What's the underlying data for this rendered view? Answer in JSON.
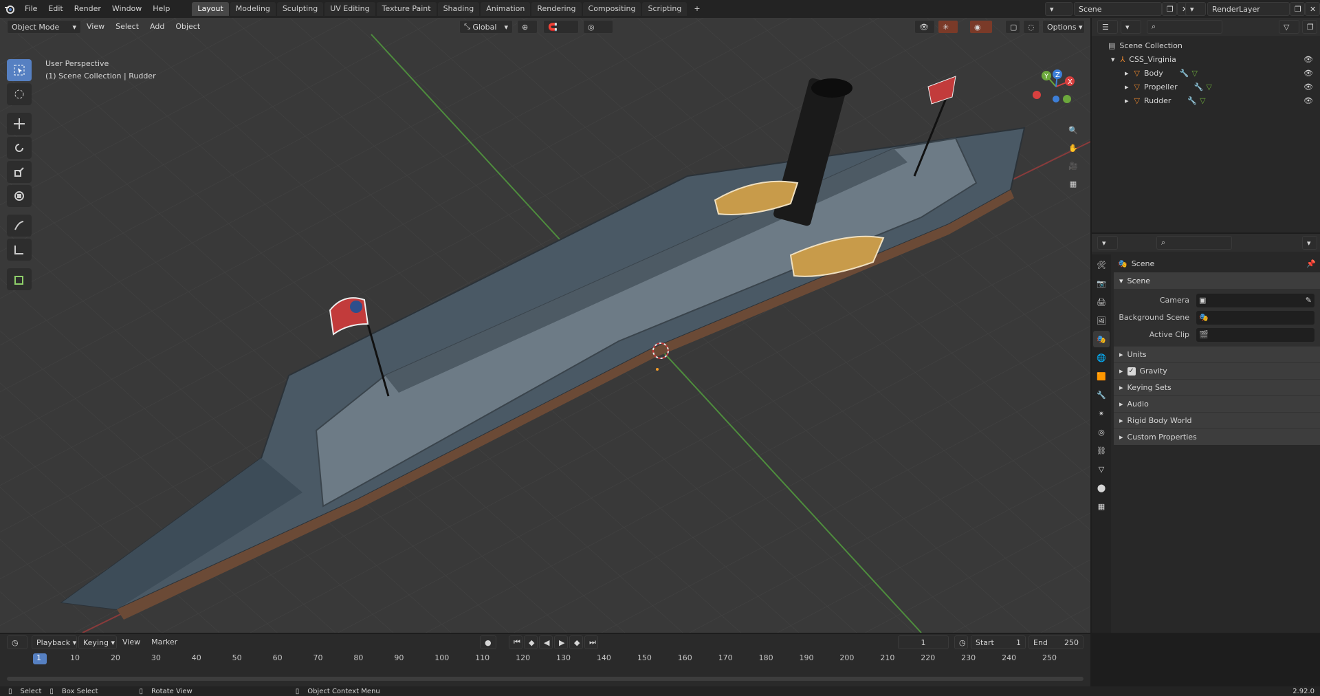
{
  "menu": {
    "items": [
      "File",
      "Edit",
      "Render",
      "Window",
      "Help"
    ]
  },
  "workspaces": [
    "Layout",
    "Modeling",
    "Sculpting",
    "UV Editing",
    "Texture Paint",
    "Shading",
    "Animation",
    "Rendering",
    "Compositing",
    "Scripting"
  ],
  "active_workspace": "Layout",
  "top_right": {
    "scene": "Scene",
    "view_layer": "RenderLayer"
  },
  "viewport": {
    "mode": "Object Mode",
    "menus": [
      "View",
      "Select",
      "Add",
      "Object"
    ],
    "transform_orientation": "Global",
    "options_label": "Options",
    "overlay_title": "User Perspective",
    "overlay_sub": "(1) Scene Collection | Rudder",
    "gizmo": {
      "x": "X",
      "y": "Y",
      "z": "Z"
    }
  },
  "outliner": {
    "root": "Scene Collection",
    "collection": "CSS_Virginia",
    "objects": [
      "Body",
      "Propeller",
      "Rudder"
    ]
  },
  "properties": {
    "context": "Scene",
    "panel": "Scene",
    "fields": [
      {
        "label": "Camera"
      },
      {
        "label": "Background Scene"
      },
      {
        "label": "Active Clip"
      }
    ],
    "subpanels": [
      "Units",
      "Gravity",
      "Keying Sets",
      "Audio",
      "Rigid Body World",
      "Custom Properties"
    ],
    "gravity_checked": true
  },
  "timeline": {
    "menus": [
      "Playback",
      "Keying",
      "View",
      "Marker"
    ],
    "current_frame": "1",
    "start_label": "Start",
    "start": "1",
    "end_label": "End",
    "end": "250",
    "ticks": [
      "1",
      "10",
      "20",
      "30",
      "40",
      "50",
      "60",
      "70",
      "80",
      "90",
      "100",
      "110",
      "120",
      "130",
      "140",
      "150",
      "160",
      "170",
      "180",
      "190",
      "200",
      "210",
      "220",
      "230",
      "240",
      "250"
    ]
  },
  "statusbar": {
    "select": "Select",
    "box_select": "Box Select",
    "rotate": "Rotate View",
    "context_menu": "Object Context Menu",
    "version": "2.92.0"
  },
  "colors": {
    "accent": "#5680c2",
    "x_axis": "#d8403f",
    "y_axis": "#6ca83c",
    "z_axis": "#3d7fd8",
    "object_orange": "#e8862e"
  }
}
